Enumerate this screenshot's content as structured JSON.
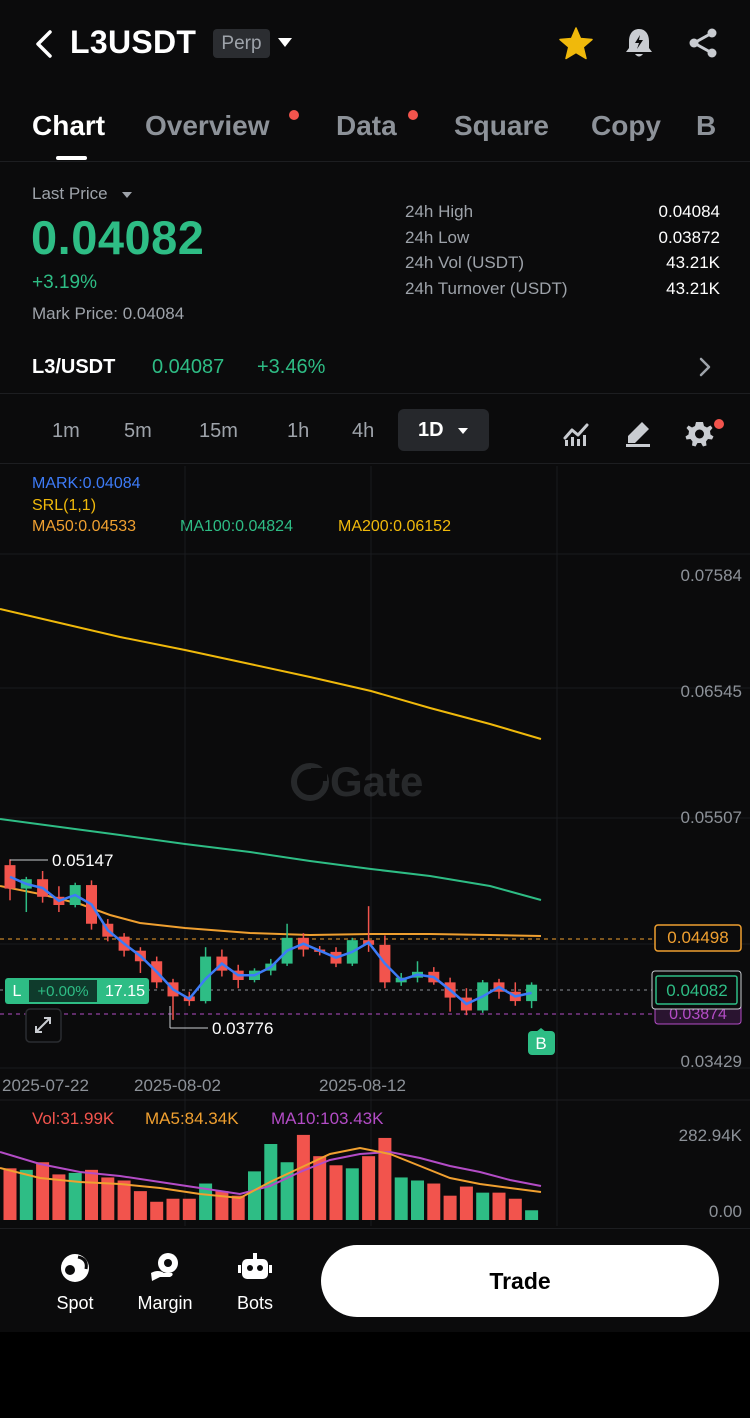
{
  "header": {
    "title": "L3USDT",
    "badge": "Perp",
    "icons": [
      "back-arrow-icon",
      "star-icon",
      "bell-alert-icon",
      "share-icon"
    ]
  },
  "tabs": [
    {
      "label": "Chart",
      "active": true,
      "dot": false
    },
    {
      "label": "Overview",
      "active": false,
      "dot": true
    },
    {
      "label": "Data",
      "active": false,
      "dot": true
    },
    {
      "label": "Square",
      "active": false,
      "dot": false
    },
    {
      "label": "Copy",
      "active": false,
      "dot": false
    },
    {
      "label": "B",
      "active": false,
      "dot": false
    }
  ],
  "price": {
    "last_price_label": "Last Price",
    "last_price": "0.04082",
    "change_pct": "+3.19%",
    "mark_label": "Mark Price:",
    "mark_value": "0.04084"
  },
  "stats": [
    {
      "label": "24h High",
      "value": "0.04084"
    },
    {
      "label": "24h Low",
      "value": "0.03872"
    },
    {
      "label": "24h Vol (USDT)",
      "value": "43.21K"
    },
    {
      "label": "24h Turnover (USDT)",
      "value": "43.21K"
    }
  ],
  "spot": {
    "pair": "L3/USDT",
    "price": "0.04087",
    "pct": "+3.46%"
  },
  "timeframes": [
    "1m",
    "5m",
    "15m",
    "1h",
    "4h"
  ],
  "timeframe_active": "1D",
  "indicators": {
    "mark": "MARK:0.04084",
    "srl": "SRL(1,1)",
    "ma50": "MA50:0.04533",
    "ma100": "MA100:0.04824",
    "ma200": "MA200:0.06152",
    "colors": {
      "mark": "#3d7bf7",
      "srl": "#f0b90b",
      "ma50": "#f0a030",
      "ma100": "#2ebd85",
      "ma200": "#f0b90b"
    }
  },
  "chart": {
    "watermark": "Gate",
    "price_axis": [
      "0.07584",
      "0.06545",
      "0.05507",
      "0.03429"
    ],
    "date_axis": [
      "2025-07-22",
      "2025-08-02",
      "2025-08-12"
    ],
    "high_label": "0.05147",
    "low_label": "0.03776",
    "tag_ma50": "0.04498",
    "tag_last": "0.04082",
    "tag_mark": "0.03874",
    "position": {
      "side": "L",
      "pnl": "+0.00%",
      "size": "17.15"
    },
    "buy_marker": "B"
  },
  "volume": {
    "vol": "Vol:31.99K",
    "ma5": "MA5:84.34K",
    "ma10": "MA10:103.43K",
    "axis_top": "282.94K",
    "axis_bottom": "0.00"
  },
  "bottom_nav": [
    {
      "label": "Spot",
      "icon": "spot-icon"
    },
    {
      "label": "Margin",
      "icon": "margin-icon"
    },
    {
      "label": "Bots",
      "icon": "bots-icon"
    }
  ],
  "trade_label": "Trade",
  "chart_data": {
    "type": "candlestick",
    "x": [
      "2025-07-22",
      "2025-08-02",
      "2025-08-12"
    ],
    "ohlc": [
      {
        "o": 0.051,
        "h": 0.0515,
        "l": 0.048,
        "c": 0.049
      },
      {
        "o": 0.049,
        "h": 0.05,
        "l": 0.047,
        "c": 0.0498
      },
      {
        "o": 0.0498,
        "h": 0.0505,
        "l": 0.0478,
        "c": 0.0483
      },
      {
        "o": 0.0483,
        "h": 0.0492,
        "l": 0.047,
        "c": 0.0476
      },
      {
        "o": 0.0476,
        "h": 0.0495,
        "l": 0.0474,
        "c": 0.0493
      },
      {
        "o": 0.0493,
        "h": 0.0497,
        "l": 0.0455,
        "c": 0.046
      },
      {
        "o": 0.046,
        "h": 0.0464,
        "l": 0.0445,
        "c": 0.0449
      },
      {
        "o": 0.0449,
        "h": 0.0452,
        "l": 0.0432,
        "c": 0.0437
      },
      {
        "o": 0.0437,
        "h": 0.044,
        "l": 0.0418,
        "c": 0.0428
      },
      {
        "o": 0.0428,
        "h": 0.0432,
        "l": 0.0405,
        "c": 0.041
      },
      {
        "o": 0.041,
        "h": 0.0413,
        "l": 0.0378,
        "c": 0.0398
      },
      {
        "o": 0.0398,
        "h": 0.0402,
        "l": 0.039,
        "c": 0.0394
      },
      {
        "o": 0.0394,
        "h": 0.044,
        "l": 0.0392,
        "c": 0.0432
      },
      {
        "o": 0.0432,
        "h": 0.0438,
        "l": 0.0415,
        "c": 0.042
      },
      {
        "o": 0.042,
        "h": 0.0425,
        "l": 0.0405,
        "c": 0.0412
      },
      {
        "o": 0.0412,
        "h": 0.0422,
        "l": 0.041,
        "c": 0.042
      },
      {
        "o": 0.042,
        "h": 0.043,
        "l": 0.0416,
        "c": 0.0426
      },
      {
        "o": 0.0426,
        "h": 0.046,
        "l": 0.0424,
        "c": 0.0448
      },
      {
        "o": 0.0448,
        "h": 0.0452,
        "l": 0.0432,
        "c": 0.0438
      },
      {
        "o": 0.0438,
        "h": 0.0441,
        "l": 0.0433,
        "c": 0.0436
      },
      {
        "o": 0.0436,
        "h": 0.044,
        "l": 0.0423,
        "c": 0.0426
      },
      {
        "o": 0.0426,
        "h": 0.0448,
        "l": 0.0424,
        "c": 0.0446
      },
      {
        "o": 0.0446,
        "h": 0.0475,
        "l": 0.0436,
        "c": 0.0442
      },
      {
        "o": 0.0442,
        "h": 0.045,
        "l": 0.0405,
        "c": 0.041
      },
      {
        "o": 0.041,
        "h": 0.0418,
        "l": 0.0407,
        "c": 0.0414
      },
      {
        "o": 0.0414,
        "h": 0.0428,
        "l": 0.041,
        "c": 0.0419
      },
      {
        "o": 0.0419,
        "h": 0.0423,
        "l": 0.0408,
        "c": 0.041
      },
      {
        "o": 0.041,
        "h": 0.0414,
        "l": 0.0385,
        "c": 0.0397
      },
      {
        "o": 0.0397,
        "h": 0.0405,
        "l": 0.0382,
        "c": 0.0386
      },
      {
        "o": 0.0386,
        "h": 0.0412,
        "l": 0.0384,
        "c": 0.041
      },
      {
        "o": 0.041,
        "h": 0.0413,
        "l": 0.0396,
        "c": 0.0402
      },
      {
        "o": 0.0402,
        "h": 0.041,
        "l": 0.039,
        "c": 0.0394
      },
      {
        "o": 0.0394,
        "h": 0.041,
        "l": 0.0388,
        "c": 0.0408
      }
    ],
    "volume": [
      170,
      165,
      190,
      150,
      155,
      165,
      140,
      130,
      95,
      60,
      70,
      70,
      120,
      95,
      80,
      160,
      250,
      190,
      280,
      210,
      180,
      170,
      210,
      270,
      140,
      130,
      120,
      80,
      110,
      90,
      90,
      70,
      32
    ]
  }
}
